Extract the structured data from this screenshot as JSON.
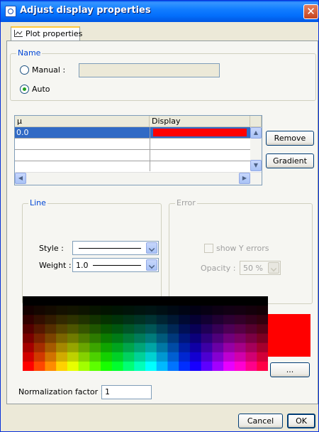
{
  "window": {
    "title": "Adjust display properties",
    "close_glyph": "✕"
  },
  "tabs": [
    {
      "label": "Plot properties",
      "icon": "line-chart-icon"
    }
  ],
  "name_group": {
    "title": "Name",
    "manual_label": "Manual :",
    "manual_value": "",
    "auto_label": "Auto",
    "selected": "Auto"
  },
  "table": {
    "columns": [
      "µ",
      "Display"
    ],
    "rows": [
      {
        "mu": "0.0",
        "display_color": "#ff0000",
        "selected": true
      },
      {
        "mu": "",
        "display_color": ""
      },
      {
        "mu": "",
        "display_color": ""
      }
    ],
    "remove_label": "Remove",
    "gradient_label": "Gradient"
  },
  "line_group": {
    "title": "Line",
    "style_label": "Style :",
    "weight_label": "Weight :",
    "weight_value": "1.0"
  },
  "error_group": {
    "title": "Error",
    "show_y_label": "show Y errors",
    "show_y_checked": false,
    "opacity_label": "Opacity :",
    "opacity_value": "50 %"
  },
  "color": {
    "selected_hex": "#ff0000",
    "more_label": "..."
  },
  "normalization": {
    "label": "Normalization factor :",
    "value": "1"
  },
  "footer": {
    "cancel_label": "Cancel",
    "ok_label": "OK"
  }
}
